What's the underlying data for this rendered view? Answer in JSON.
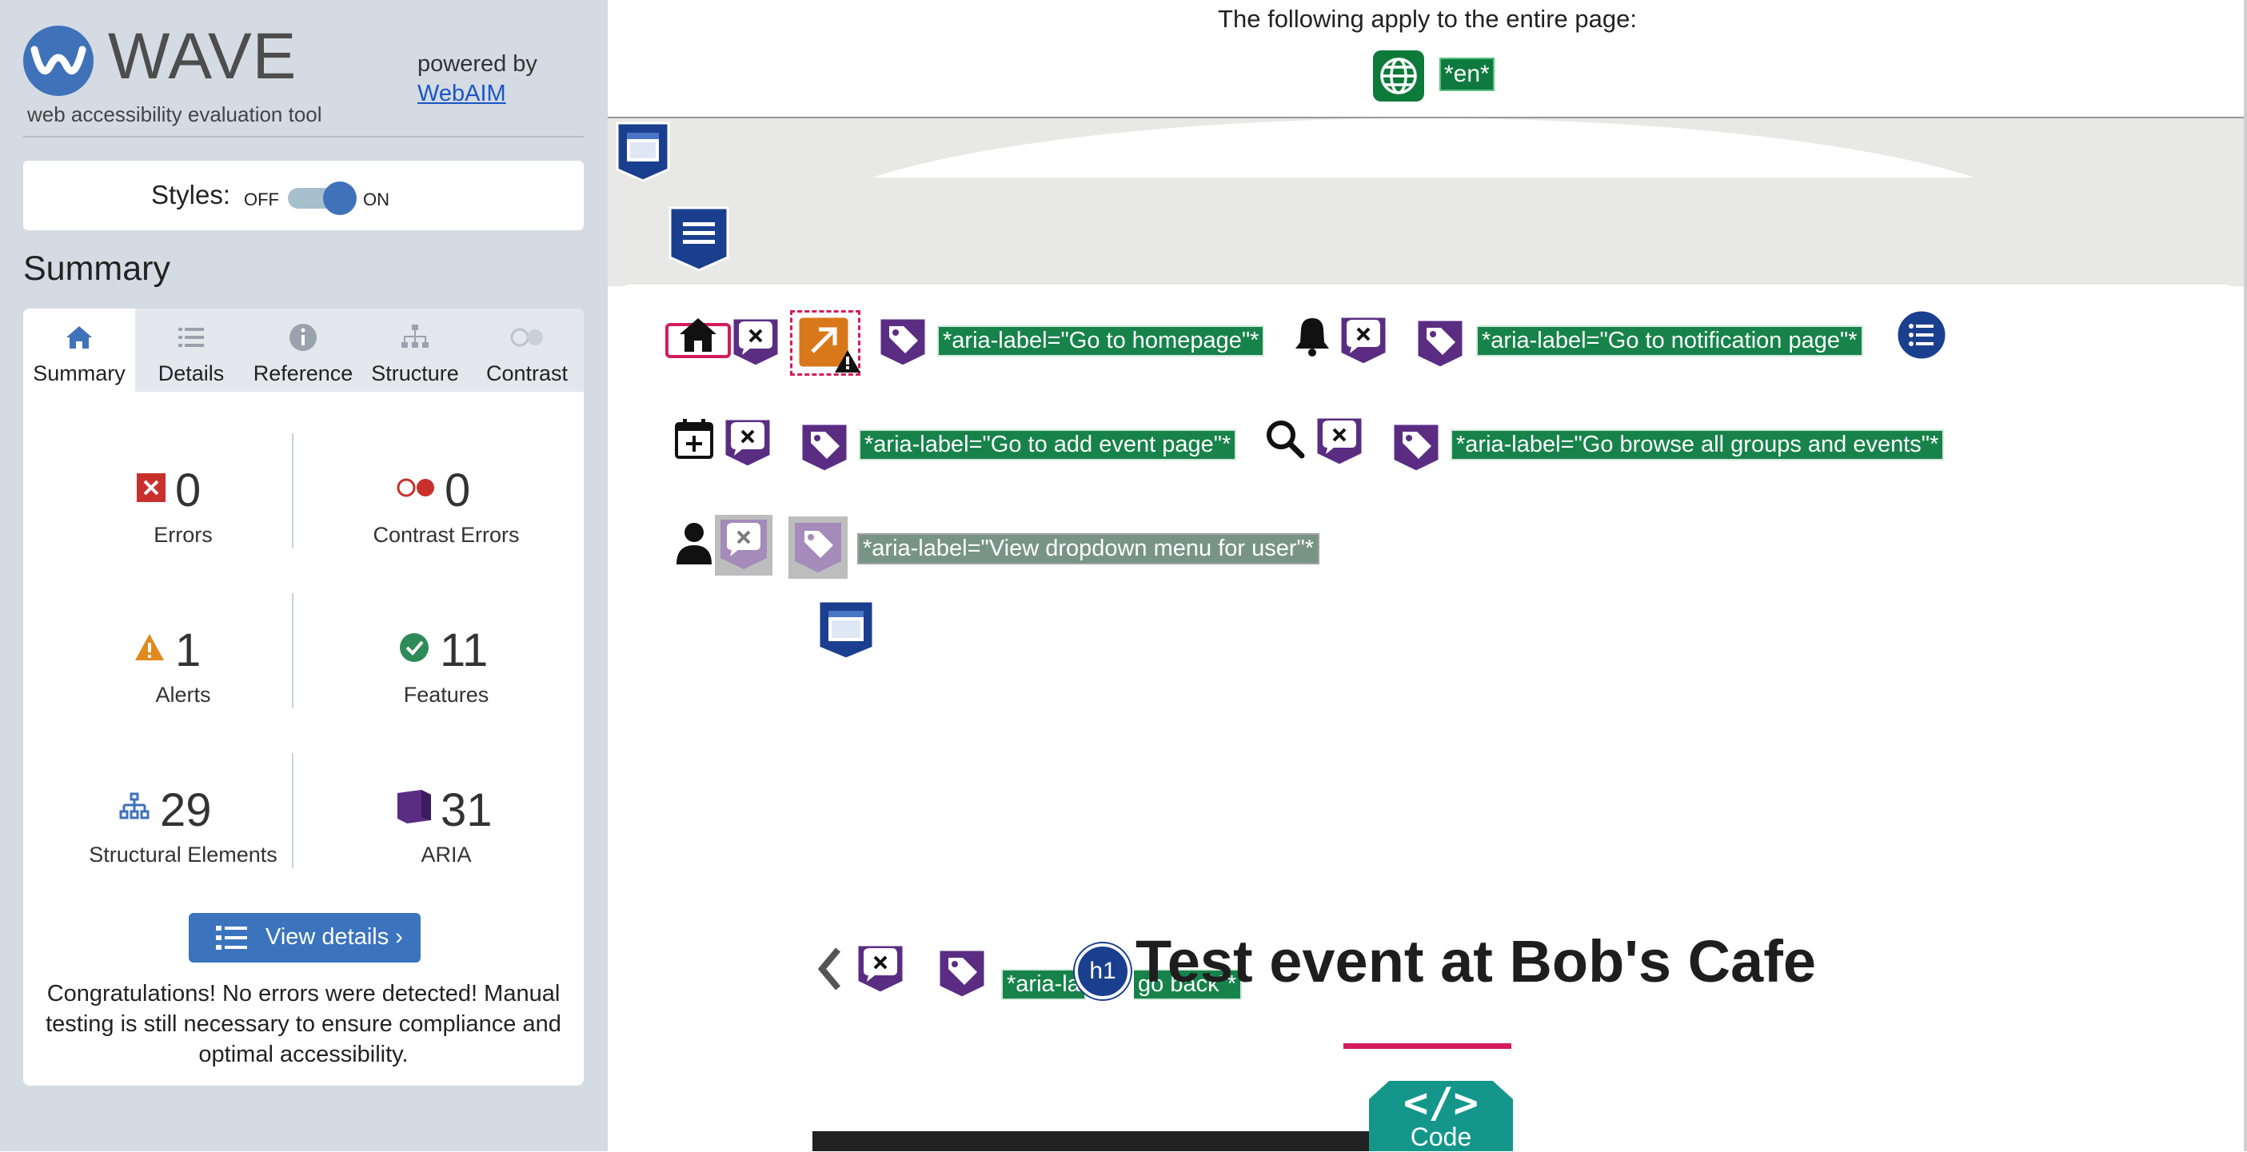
{
  "wave": {
    "logo_word": "WAVE",
    "logo_tagline": "web accessibility evaluation tool",
    "powered_by": "powered by",
    "powered_link": "WebAIM",
    "styles_label": "Styles:",
    "styles_off": "OFF",
    "styles_on": "ON",
    "styles_enabled": true,
    "summary_heading": "Summary",
    "tabs": [
      {
        "label": "Summary",
        "icon": "home-icon",
        "active": true
      },
      {
        "label": "Details",
        "icon": "list-icon",
        "active": false
      },
      {
        "label": "Reference",
        "icon": "info-icon",
        "active": false
      },
      {
        "label": "Structure",
        "icon": "hierarchy-icon",
        "active": false
      },
      {
        "label": "Contrast",
        "icon": "contrast-icon",
        "active": false
      }
    ],
    "stats": {
      "errors": {
        "count": "0",
        "label": "Errors",
        "icon": "error-icon"
      },
      "contrast_errors": {
        "count": "0",
        "label": "Contrast Errors",
        "icon": "contrast-error-icon"
      },
      "alerts": {
        "count": "1",
        "label": "Alerts",
        "icon": "alert-icon"
      },
      "features": {
        "count": "11",
        "label": "Features",
        "icon": "feature-check-icon"
      },
      "structural": {
        "count": "29",
        "label": "Structural Elements",
        "icon": "structure-icon"
      },
      "aria": {
        "count": "31",
        "label": "ARIA",
        "icon": "aria-icon"
      }
    },
    "view_details_label": "View details ›",
    "congrats": "Congratulations! No errors were detected! Manual testing is still necessary to ensure compliance and optimal accessibility."
  },
  "page": {
    "applies_text": "The following apply to the entire page:",
    "lang_label": "*en*",
    "aria_labels": {
      "homepage": "*aria-label=\"Go to homepage\"*",
      "notification": "*aria-label=\"Go to notification page\"*",
      "add_event": "*aria-label=\"Go to add event page\"*",
      "browse": "*aria-label=\"Go browse all groups and events\"*",
      "user_menu": "*aria-label=\"View dropdown menu for user\"*",
      "go_back_a": "*aria-la",
      "go_back_b": "go back\"*"
    },
    "h1_badge": "h1",
    "event_title": "Test event at Bob's Cafe",
    "code_badge_symbol": "</>",
    "code_badge_label": "Code"
  },
  "colors": {
    "wave_blue": "#3f72b9",
    "aria_purple": "#5a2d82",
    "feature_green": "#17834a",
    "error_red": "#c9302c",
    "alert_orange": "#e08a1e",
    "accent_pink": "#d41c5c",
    "code_teal": "#14978a"
  }
}
